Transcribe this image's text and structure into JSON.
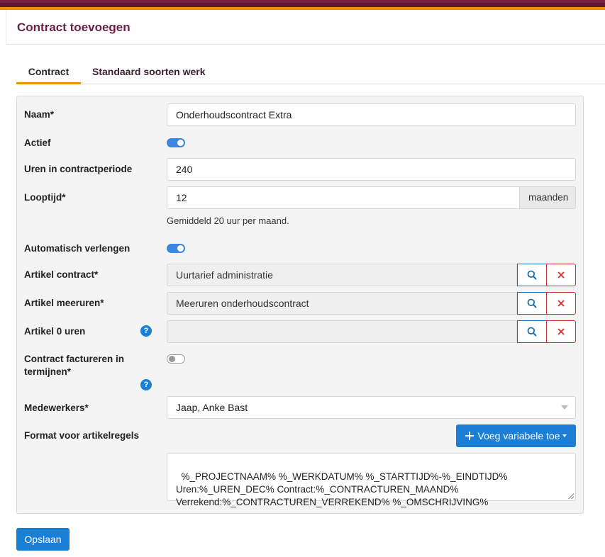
{
  "header": {
    "title": "Contract toevoegen"
  },
  "tabs": [
    {
      "label": "Contract",
      "active": true
    },
    {
      "label": "Standaard soorten werk",
      "active": false
    }
  ],
  "form": {
    "naam": {
      "label": "Naam*",
      "value": "Onderhoudscontract Extra"
    },
    "actief": {
      "label": "Actief",
      "on": true
    },
    "uren": {
      "label": "Uren in contractperiode",
      "value": "240"
    },
    "looptijd": {
      "label": "Looptijd*",
      "value": "12",
      "suffix": "maanden",
      "hint": "Gemiddeld 20 uur per maand."
    },
    "verlengen": {
      "label": "Automatisch verlengen",
      "on": true
    },
    "artikel_contract": {
      "label": "Artikel contract*",
      "value": "Uurtarief administratie"
    },
    "artikel_meeruren": {
      "label": "Artikel meeruren*",
      "value": "Meeruren onderhoudscontract"
    },
    "artikel_0": {
      "label": "Artikel 0 uren",
      "value": ""
    },
    "factureren": {
      "label_line1": "Contract factureren in",
      "label_line2": "termijnen*",
      "on": false
    },
    "medewerkers": {
      "label": "Medewerkers*",
      "value": "Jaap, Anke Bast"
    },
    "format": {
      "label": "Format voor artikelregels",
      "button": "Voeg variabele toe",
      "value": "%_PROJECTNAAM% %_WERKDATUM% %_STARTTIJD%-%_EINDTIJD%\nUren:%_UREN_DEC% Contract:%_CONTRACTUREN_MAAND%\nVerrekend:%_CONTRACTUREN_VERREKEND% %_OMSCHRIJVING%"
    },
    "help_glyph": "?"
  },
  "save_button": "Opslaan",
  "colors": {
    "brand": "#6b1f45",
    "accent": "#f39200",
    "primary": "#1b7fd6",
    "danger": "#d0312d"
  },
  "icons": {
    "search": "search-icon",
    "clear": "close-icon",
    "help": "question-icon",
    "plus": "plus-icon",
    "caret": "caret-down-icon"
  }
}
